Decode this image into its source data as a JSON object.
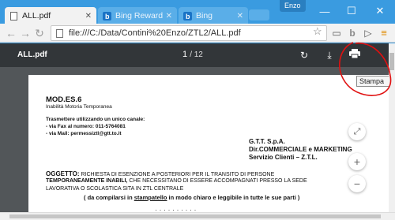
{
  "browser": {
    "tabs": [
      {
        "title": "ALL.pdf",
        "icon": "page-icon",
        "active": true
      },
      {
        "title": "Bing Rewards - Enz",
        "icon": "bing-icon",
        "active": false
      },
      {
        "title": "Bing",
        "icon": "bing-icon",
        "active": false
      }
    ],
    "user_label": "Enzo",
    "url": "file:///C:/Data/Contini%20Enzo/ZTL2/ALL.pdf",
    "accent": "#3a9be0"
  },
  "pdf": {
    "title": "ALL.pdf",
    "current_page": "1",
    "total_pages": "/ 12",
    "tooltip": "Stampa"
  },
  "document": {
    "heading": "MOD.ES.6",
    "subheading": "Inabilità Motoria Temporanea",
    "transmit_title": "Trasmettere utilizzando un unico canale:",
    "fax_line": "- via Fax al numero: 011-5764081",
    "mail_line": "- via Mail: permessiztl@gtt.to.it",
    "recipient": [
      "G.T.T. S.p.A.",
      "Dir.COMMERCIALE e MARKETING",
      "Servizio Clienti – Z.T.L."
    ],
    "subject_label": "OGGETTO:",
    "subject_line1": "RICHIESTA DI ESENZIONE A POSTERIORI PER IL TRANSITO DI PERSONE",
    "subject_line2_bold": "TEMPORANEAMENTE INABILI,",
    "subject_line2_rest": "CHE NECESSITANO DI ESSERE ACCOMPAGNATI PRESSO  LA SEDE",
    "subject_line3": "LAVORATIVA O SCOLASTICA SITA  IN ZTL CENTRALE",
    "instruction_pre": "( da compilarsi in ",
    "instruction_under": "stampatello",
    "instruction_post": " in modo chiaro e leggibile in tutte le sue parti )"
  }
}
